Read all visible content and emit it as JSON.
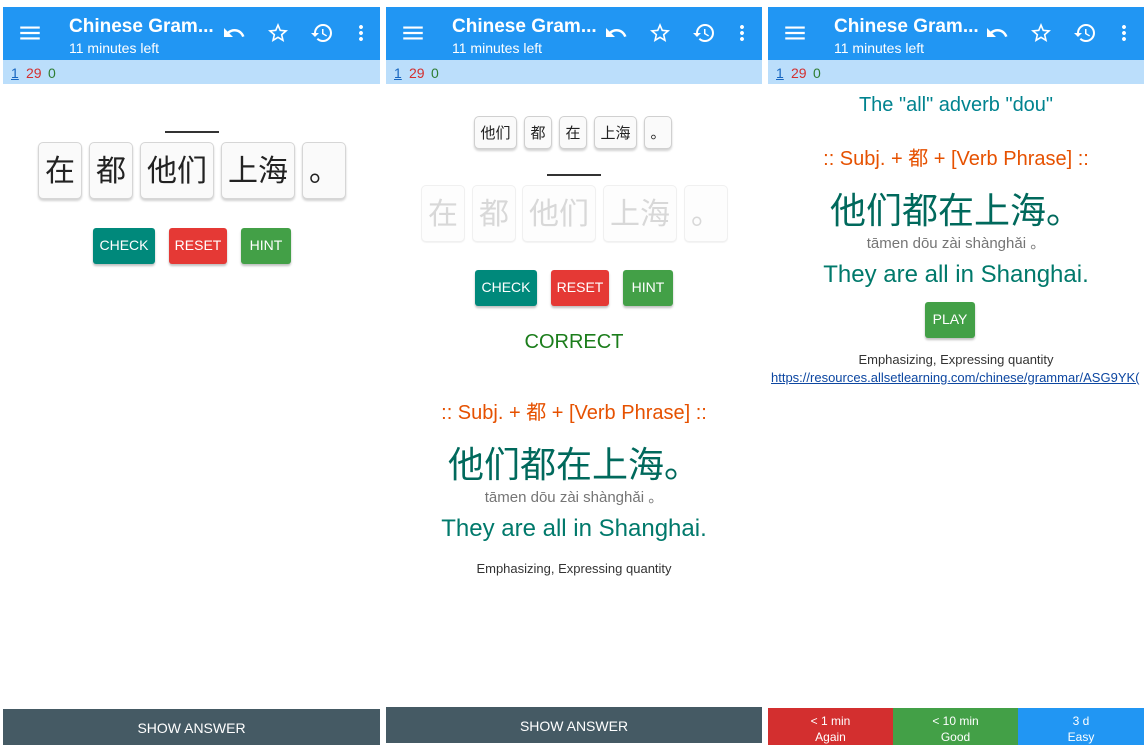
{
  "screens": [
    {
      "app_title": "Chinese Gram...",
      "time_left": "11 minutes left",
      "counts": {
        "new": "1",
        "learning": "29",
        "review": "0"
      },
      "tiles": [
        "在",
        "都",
        "他们",
        "上海",
        "。"
      ],
      "buttons": {
        "check": "CHECK",
        "reset": "RESET",
        "hint": "HINT"
      },
      "show_answer": "SHOW ANSWER"
    },
    {
      "app_title": "Chinese Gram...",
      "time_left": "11 minutes left",
      "counts": {
        "new": "1",
        "learning": "29",
        "review": "0"
      },
      "answer_tiles": [
        "他们",
        "都",
        "在",
        "上海",
        "。"
      ],
      "tiles": [
        "在",
        "都",
        "他们",
        "上海",
        "。"
      ],
      "buttons": {
        "check": "CHECK",
        "reset": "RESET",
        "hint": "HINT"
      },
      "result": "CORRECT",
      "pattern": ":: Subj. + 都 + [Verb Phrase] ::",
      "hanzi": "他们都在上海。",
      "pinyin": "tāmen dōu zài shànghǎi 。",
      "english": "They are all in Shanghai.",
      "topic": "Emphasizing, Expressing quantity",
      "show_answer": "SHOW ANSWER"
    },
    {
      "app_title": "Chinese Gram...",
      "time_left": "11 minutes left",
      "counts": {
        "new": "1",
        "learning": "29",
        "review": "0"
      },
      "heading": "The \"all\" adverb \"dou\"",
      "pattern": ":: Subj. + 都 + [Verb Phrase] ::",
      "hanzi": "他们都在上海。",
      "pinyin": "tāmen dōu zài shànghǎi 。",
      "english": "They are all in Shanghai.",
      "play": "PLAY",
      "topic": "Emphasizing, Expressing quantity",
      "link": "https://resources.allsetlearning.com/chinese/grammar/ASG9YK(",
      "ease": [
        {
          "time": "< 1 min",
          "label": "Again"
        },
        {
          "time": "< 10 min",
          "label": "Good"
        },
        {
          "time": "3 d",
          "label": "Easy"
        }
      ]
    }
  ],
  "colors": {
    "appbar": "#2196f3",
    "countbar": "#bbdefb",
    "check": "#00897b",
    "reset": "#e53935",
    "hint": "#43a047",
    "show_answer_bar": "#455a64"
  },
  "icons": [
    "menu-icon",
    "undo-icon",
    "star-icon",
    "history-icon",
    "more-vert-icon"
  ]
}
